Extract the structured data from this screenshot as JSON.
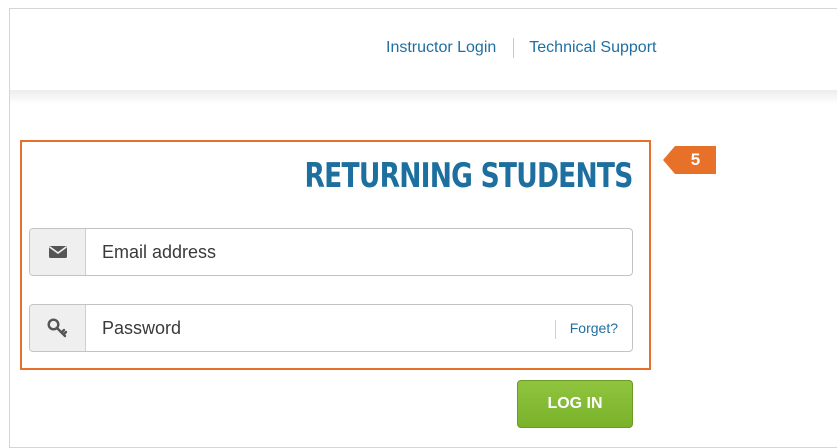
{
  "nav": {
    "instructor_login": "Instructor Login",
    "technical_support": "Technical Support"
  },
  "callout": {
    "number": "5",
    "color": "#e8712a"
  },
  "section": {
    "title": "RETURNING STUDENTS"
  },
  "form": {
    "email": {
      "placeholder": "Email address",
      "value": "",
      "icon": "envelope-icon"
    },
    "password": {
      "placeholder": "Password",
      "value": "",
      "icon": "key-icon",
      "forget_label": "Forget?"
    },
    "login_label": "LOG IN"
  },
  "colors": {
    "brand_blue": "#1d6f9f",
    "login_green": "#7ab22a",
    "callout_orange": "#e8712a"
  }
}
